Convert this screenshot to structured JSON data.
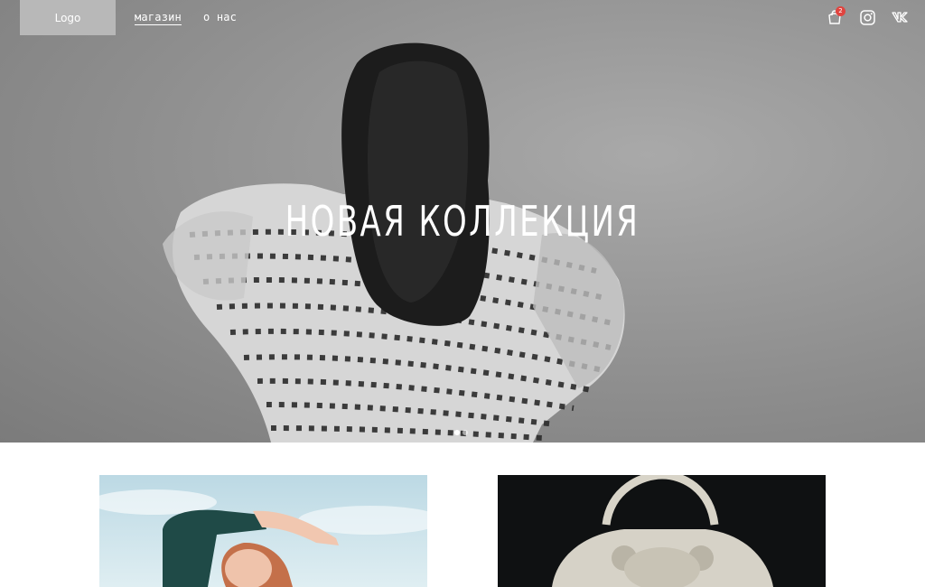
{
  "header": {
    "logo_label": "Logo",
    "nav": [
      {
        "label": "магазин",
        "active": true
      },
      {
        "label": "о нас",
        "active": false
      }
    ],
    "icons": [
      "cart-icon",
      "instagram-icon",
      "vk-icon"
    ],
    "cart_count": "2"
  },
  "hero": {
    "title": "НОВАЯ КОЛЛЕКЦИЯ",
    "slides": 2,
    "active_slide": 1
  },
  "products": [
    {
      "name": "product-card-sweater"
    },
    {
      "name": "product-card-bag"
    }
  ],
  "colors": {
    "badge": "#e0443f",
    "logo_bg": "#b8b8b8",
    "text": "#ffffff"
  }
}
